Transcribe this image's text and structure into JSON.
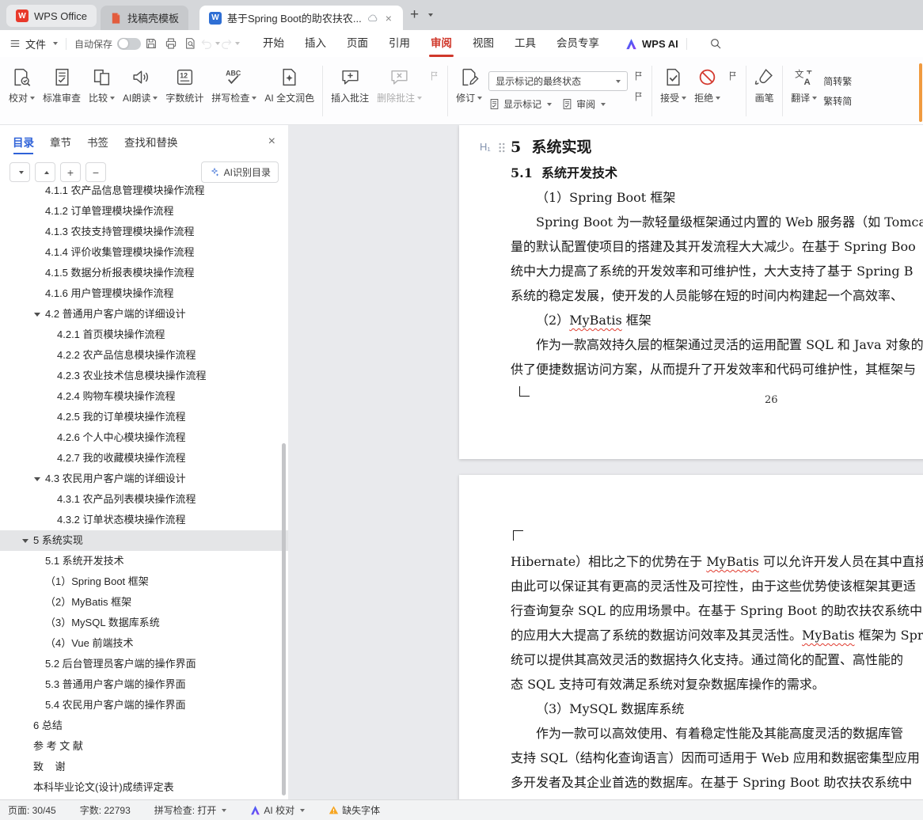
{
  "tabbar": {
    "home": "WPS Office",
    "template_tab": "找稿壳模板",
    "document_tab": "基于Spring Boot的助农扶农..."
  },
  "glyphs": {
    "new_tab": "+",
    "close_tab": "×",
    "close_panel": "×",
    "plus": "+",
    "minus": "−"
  },
  "menubar": {
    "file": "文件",
    "autosave": "自动保存",
    "autosave_on": false,
    "tabs": [
      "开始",
      "插入",
      "页面",
      "引用",
      "审阅",
      "视图",
      "工具",
      "会员专享"
    ],
    "active_tab": "审阅",
    "wps_ai": "WPS AI"
  },
  "ribbon": {
    "proofread": "校对",
    "standard_review": "标准审查",
    "compare": "比较",
    "ai_read": "AI朗读",
    "word_count": "字数统计",
    "spell_check": "拼写检查",
    "ai_polish": "AI 全文润色",
    "insert_comment": "插入批注",
    "delete_comment": "删除批注",
    "markup_state": "显示标记的最终状态",
    "track_changes": "修订",
    "show_markup": "显示标记",
    "review": "审阅",
    "accept": "接受",
    "reject": "拒绝",
    "brush": "画笔",
    "translate": "翻译",
    "s2t": "简转繁",
    "t2s": "繁转简"
  },
  "sidebar": {
    "tabs": [
      {
        "label": "目录",
        "active": true
      },
      {
        "label": "章节"
      },
      {
        "label": "书签"
      },
      {
        "label": "查找和替换"
      }
    ],
    "ai_recognize": "AI识别目录",
    "toc": [
      {
        "label": "4.1.1 农产品信息管理模块操作流程",
        "indent": 1
      },
      {
        "label": "4.1.2 订单管理模块操作流程",
        "indent": 1
      },
      {
        "label": "4.1.3 农技支持管理模块操作流程",
        "indent": 1
      },
      {
        "label": "4.1.4 评价收集管理模块操作流程",
        "indent": 1
      },
      {
        "label": "4.1.5 数据分析报表模块操作流程",
        "indent": 1
      },
      {
        "label": "4.1.6 用户管理模块操作流程",
        "indent": 1
      },
      {
        "label": "4.2 普通用户客户端的详细设计",
        "indent": 1,
        "arrow": true
      },
      {
        "label": "4.2.1 首页模块操作流程",
        "indent": 2
      },
      {
        "label": "4.2.2 农产品信息模块操作流程",
        "indent": 2
      },
      {
        "label": "4.2.3 农业技术信息模块操作流程",
        "indent": 2
      },
      {
        "label": "4.2.4 购物车模块操作流程",
        "indent": 2
      },
      {
        "label": "4.2.5 我的订单模块操作流程",
        "indent": 2
      },
      {
        "label": "4.2.6 个人中心模块操作流程",
        "indent": 2
      },
      {
        "label": "4.2.7 我的收藏模块操作流程",
        "indent": 2
      },
      {
        "label": "4.3 农民用户客户端的详细设计",
        "indent": 1,
        "arrow": true
      },
      {
        "label": "4.3.1 农产品列表模块操作流程",
        "indent": 2
      },
      {
        "label": "4.3.2 订单状态模块操作流程",
        "indent": 2
      },
      {
        "label": "5 系统实现",
        "indent": 0,
        "arrow": true,
        "selected": true
      },
      {
        "label": "5.1 系统开发技术",
        "indent": 1
      },
      {
        "label": "（1）Spring Boot 框架",
        "indent": 1
      },
      {
        "label": "（2）MyBatis 框架",
        "indent": 1
      },
      {
        "label": "（3）MySQL 数据库系统",
        "indent": 1
      },
      {
        "label": "（4）Vue 前端技术",
        "indent": 1
      },
      {
        "label": "5.2 后台管理员客户端的操作界面",
        "indent": 1
      },
      {
        "label": "5.3 普通用户客户端的操作界面",
        "indent": 1
      },
      {
        "label": "5.4 农民用户客户端的操作界面",
        "indent": 1
      },
      {
        "label": "6 总结",
        "indent": 0
      },
      {
        "label": "参 考 文 献",
        "indent": 0
      },
      {
        "label": "致    谢",
        "indent": 0
      },
      {
        "label": "本科毕业论文(设计)成绩评定表",
        "indent": 0
      }
    ]
  },
  "document": {
    "h_marker": "H₁",
    "page1": {
      "heading": "5  系统实现",
      "subheading": "5.1  系统开发技术",
      "lines": [
        {
          "indent": true,
          "seg": [
            {
              "t": "（1）Spring Boot 框架"
            }
          ]
        },
        {
          "indent": true,
          "seg": [
            {
              "t": "Spring Boot 为一款轻量级框架通过内置的 Web 服务器（如 Tomcat、"
            }
          ]
        },
        {
          "seg": [
            {
              "t": "量的默认配置使项目的搭建及其开发流程大大减少。在基于 Spring Boo"
            }
          ]
        },
        {
          "seg": [
            {
              "t": "统中大力提高了系统的开发效率和可维护性，大大支持了基于 Spring B"
            }
          ]
        },
        {
          "seg": [
            {
              "t": "系统的稳定发展，使开发的人员能够在短的时间内构建起一个高效率、"
            }
          ]
        },
        {
          "indent": true,
          "seg": [
            {
              "t": "（2）"
            },
            {
              "t": "MyBatis",
              "u": true
            },
            {
              "t": " 框架"
            }
          ]
        },
        {
          "indent": true,
          "seg": [
            {
              "t": "作为一款高效持久层的框架通过灵活的运用配置 SQL 和 Java 对象的"
            }
          ]
        },
        {
          "seg": [
            {
              "t": "供了便捷数据访问方案，从而提升了开发效率和代码可维护性，其框架与"
            }
          ]
        }
      ],
      "page_number": "26"
    },
    "page2": {
      "lines": [
        {
          "seg": [
            {
              "t": "Hibernate）相比之下的优势在于 "
            },
            {
              "t": "MyBatis",
              "u": true
            },
            {
              "t": " 可以允许开发人员在其中直接编"
            }
          ]
        },
        {
          "seg": [
            {
              "t": "由此可以保证其有更高的灵活性及可控性，由于这些优势使该框架其更适"
            }
          ]
        },
        {
          "seg": [
            {
              "t": "行查询复杂 SQL 的应用场景中。在基于 Spring Boot 的助农扶农系统中"
            }
          ]
        },
        {
          "seg": [
            {
              "t": "的应用大大提高了系统的数据访问效率及其灵活性。"
            },
            {
              "t": "MyBatis",
              "u": true
            },
            {
              "t": " 框架为 Spri"
            }
          ]
        },
        {
          "seg": [
            {
              "t": "统可以提供其高效灵活的数据持久化支持。通过简化的配置、高性能的"
            }
          ]
        },
        {
          "seg": [
            {
              "t": "态 SQL 支持可有效满足系统对复杂数据库操作的需求。"
            }
          ]
        },
        {
          "indent": true,
          "seg": [
            {
              "t": "（3）MySQL 数据库系统"
            }
          ]
        },
        {
          "indent": true,
          "seg": [
            {
              "t": "作为一款可以高效使用、有着稳定性能及其能高度灵活的数据库管"
            }
          ]
        },
        {
          "seg": [
            {
              "t": "支持 SQL（结构化查询语言）因而可适用于 Web 应用和数据密集型应用"
            }
          ]
        },
        {
          "seg": [
            {
              "t": "多开发者及其企业首选的数据库。在基于 Spring Boot 助农扶农系统中"
            }
          ]
        }
      ]
    }
  },
  "statusbar": {
    "page": "页面: 30/45",
    "words": "字数: 22793",
    "spell": "拼写检查: 打开",
    "ai_proof": "AI 校对",
    "missing_font": "缺失字体"
  },
  "icons": {
    "wps_logo_letter": "W",
    "word_logo_letter": "W"
  }
}
